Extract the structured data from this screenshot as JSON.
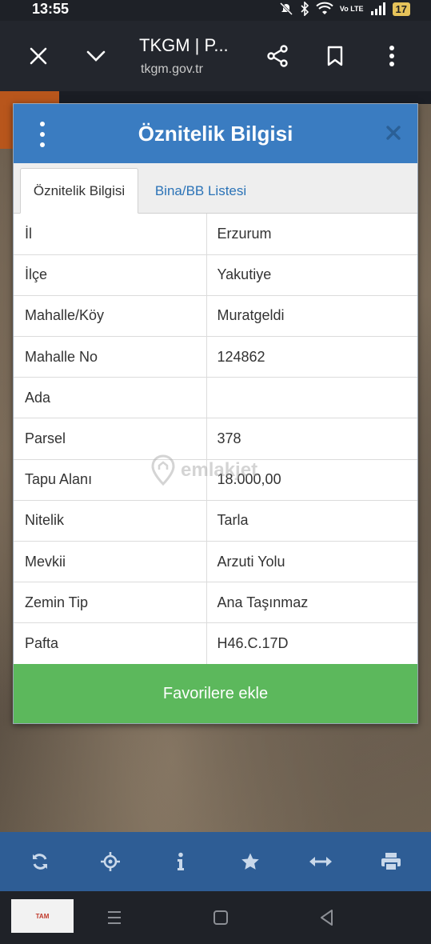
{
  "status_bar": {
    "time": "13:55",
    "network": "Vo LTE",
    "battery": "17"
  },
  "browser": {
    "title": "TKGM | P...",
    "url": "tkgm.gov.tr"
  },
  "dialog": {
    "title": "Öznitelik Bilgisi",
    "tabs": [
      {
        "label": "Öznitelik Bilgisi",
        "active": true
      },
      {
        "label": "Bina/BB Listesi",
        "active": false
      }
    ],
    "rows": [
      {
        "key": "İl",
        "value": "Erzurum"
      },
      {
        "key": "İlçe",
        "value": "Yakutiye"
      },
      {
        "key": "Mahalle/Köy",
        "value": "Muratgeldi"
      },
      {
        "key": "Mahalle No",
        "value": "124862"
      },
      {
        "key": "Ada",
        "value": ""
      },
      {
        "key": "Parsel",
        "value": "378"
      },
      {
        "key": "Tapu Alanı",
        "value": "18.000,00"
      },
      {
        "key": "Nitelik",
        "value": "Tarla"
      },
      {
        "key": "Mevkii",
        "value": "Arzuti Yolu"
      },
      {
        "key": "Zemin Tip",
        "value": "Ana Taşınmaz"
      },
      {
        "key": "Pafta",
        "value": "H46.C.17D"
      }
    ],
    "favorite_button": "Favorilere ekle"
  },
  "watermark": "emlakjet",
  "map_toolbar": {
    "items": [
      "refresh-icon",
      "locate-icon",
      "info-icon",
      "star-icon",
      "measure-icon",
      "print-icon"
    ]
  },
  "nav": {
    "thumb_label": "TAM"
  },
  "colors": {
    "header": "#3a7cc1",
    "favorite": "#5cb85c",
    "toolbar": "#2e5d95",
    "tab_link": "#2b73b7"
  }
}
